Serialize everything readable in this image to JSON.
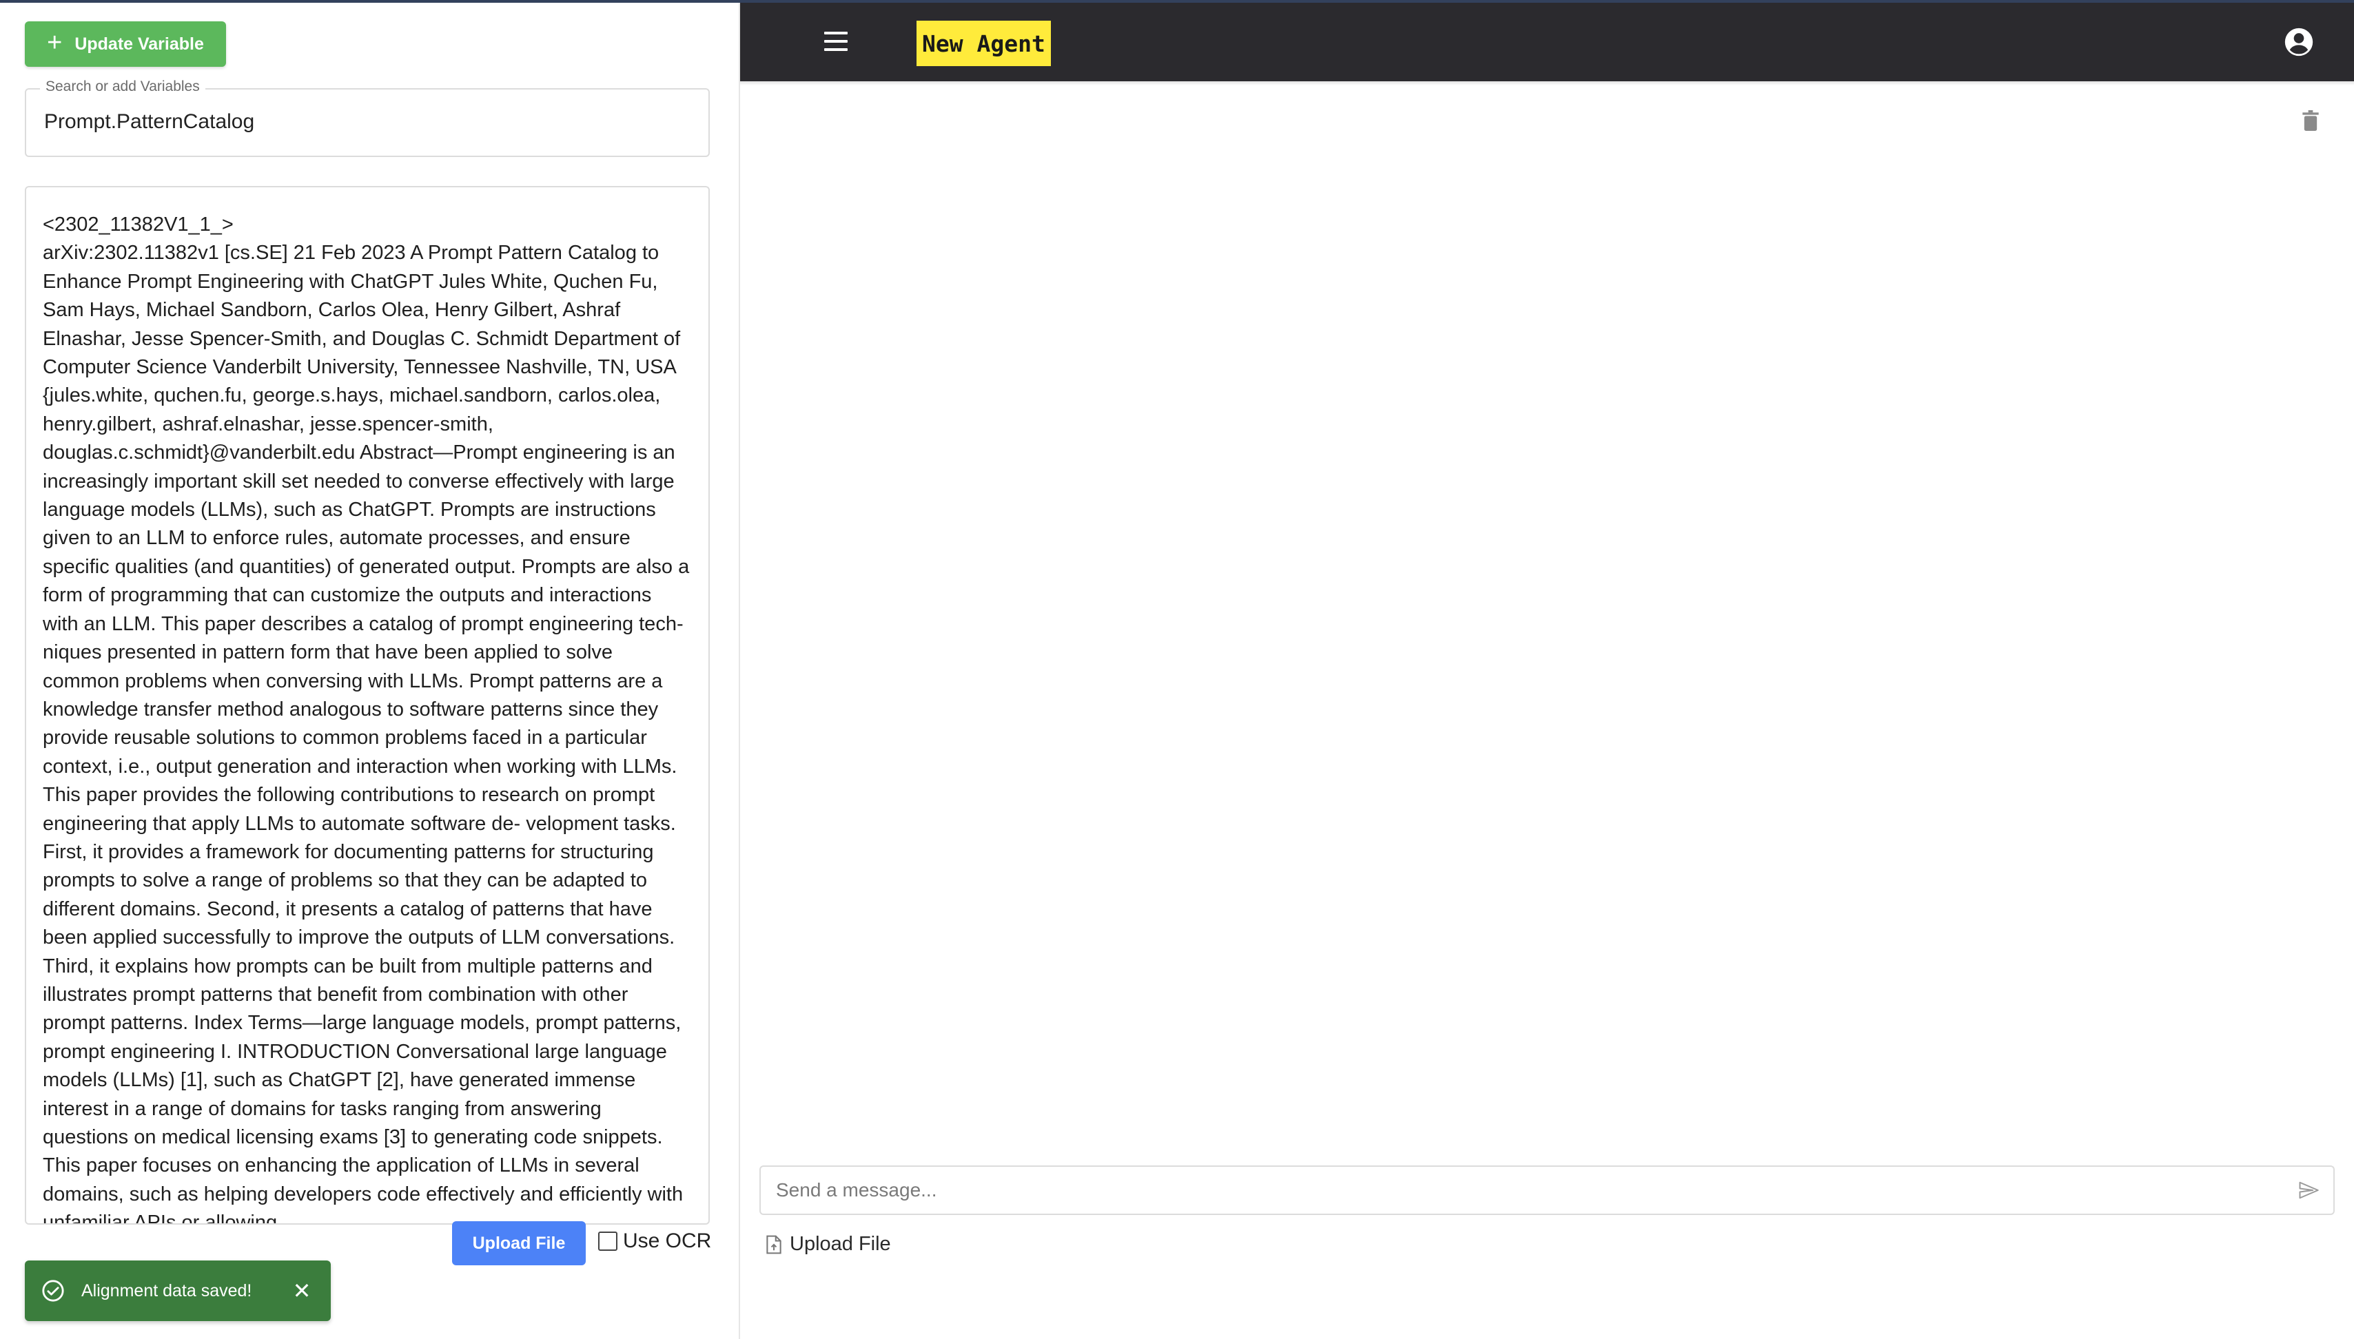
{
  "left_panel": {
    "update_button_label": "Update Variable",
    "search_legend": "Search or add Variables",
    "variable_value": "Prompt.PatternCatalog",
    "content_header": "<2302_11382V1_1_>",
    "content_body": "arXiv:2302.11382v1 [cs.SE] 21 Feb 2023 A Prompt Pattern Catalog to Enhance Prompt Engineering with ChatGPT Jules White, Quchen Fu, Sam Hays, Michael Sandborn, Carlos Olea, Henry Gilbert, Ashraf Elnashar, Jesse Spencer-Smith, and Douglas C. Schmidt Department of Computer Science Vanderbilt University, Tennessee Nashville, TN, USA {jules.white, quchen.fu, george.s.hays, michael.sandborn, carlos.olea, henry.gilbert, ashraf.elnashar, jesse.spencer-smith, douglas.c.schmidt}@vanderbilt.edu Abstract—Prompt engineering is an increasingly important skill set needed to converse effectively with large language models (LLMs), such as ChatGPT. Prompts are instructions given to an LLM to enforce rules, automate processes, and ensure specific qualities (and quantities) of generated output. Prompts are also a form of programming that can customize the outputs and interactions with an LLM. This paper describes a catalog of prompt engineering tech- niques presented in pattern form that have been applied to solve common problems when conversing with LLMs. Prompt patterns are a knowledge transfer method analogous to software patterns since they provide reusable solutions to common problems faced in a particular context, i.e., output generation and interaction when working with LLMs. This paper provides the following contributions to research on prompt engineering that apply LLMs to automate software de- velopment tasks. First, it provides a framework for documenting patterns for structuring prompts to solve a range of problems so that they can be adapted to different domains. Second, it presents a catalog of patterns that have been applied successfully to improve the outputs of LLM conversations. Third, it explains how prompts can be built from multiple patterns and illustrates prompt patterns that benefit from combination with other prompt patterns. Index Terms—large language models, prompt patterns, prompt engineering I. INTRODUCTION Conversational large language models (LLMs) [1], such as ChatGPT [2], have generated immense interest in a range of domains for tasks ranging from answering questions on medical licensing exams [3] to generating code snippets. This paper focuses on enhancing the application of LLMs in several domains, such as helping developers code effectively and efficiently with unfamiliar APIs or allowing",
    "upload_button_label": "Upload File",
    "ocr_label": "Use OCR",
    "ocr_checked": false,
    "toast_message": "Alignment data saved!",
    "toast_close": "✕"
  },
  "app_bar": {
    "title": "New Agent",
    "menu_icon": "menu-icon",
    "account_icon": "account-circle-icon"
  },
  "chat": {
    "trash_icon": "trash-icon",
    "message_placeholder": "Send a message...",
    "send_icon": "send-icon",
    "upload_label": "Upload File"
  },
  "colors": {
    "update_button": "#5cb85c",
    "upload_button": "#4c82f7",
    "toast_bg": "#3b7d3d",
    "app_bar_bg": "#2b2a2e",
    "title_highlight": "#ffeb3b"
  }
}
